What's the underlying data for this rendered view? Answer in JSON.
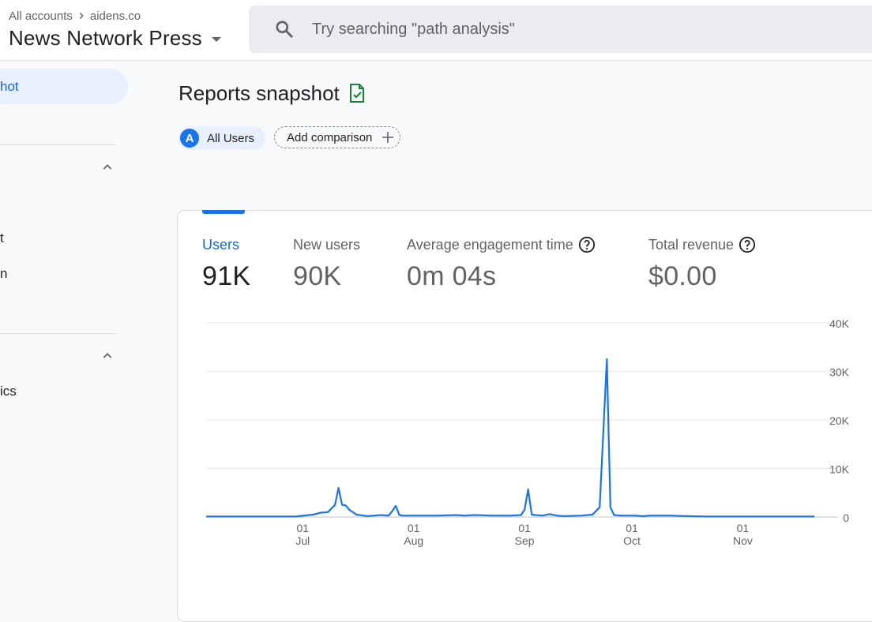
{
  "header": {
    "breadcrumb": [
      "All accounts",
      "aidens.co"
    ],
    "property_name": "News Network Press",
    "search_placeholder": "Try searching \"path analysis\""
  },
  "sidebar": {
    "active_item": "hot",
    "items": [
      "t",
      "n",
      "ics"
    ]
  },
  "main": {
    "title": "Reports snapshot",
    "comparison_chip": {
      "avatar": "A",
      "label": "All Users"
    },
    "add_comparison": "Add comparison"
  },
  "metrics": [
    {
      "label": "Users",
      "value": "91K",
      "active": true
    },
    {
      "label": "New users",
      "value": "90K",
      "active": false
    },
    {
      "label": "Average engagement time",
      "value": "0m 04s",
      "active": false
    },
    {
      "label": "Total revenue",
      "value": "$0.00",
      "active": false
    }
  ],
  "colors": {
    "accent": "#1a73e8",
    "line": "#1a73e8",
    "active_text": "#1967d2"
  },
  "chart_data": {
    "type": "line",
    "y_ticks": [
      "40K",
      "30K",
      "20K",
      "10K",
      "0"
    ],
    "ylim": [
      0,
      40000
    ],
    "x_ticks": [
      {
        "day": "01",
        "month": "Jul"
      },
      {
        "day": "01",
        "month": "Aug"
      },
      {
        "day": "01",
        "month": "Sep"
      },
      {
        "day": "01",
        "month": "Oct"
      },
      {
        "day": "01",
        "month": "Nov"
      }
    ],
    "x_range": [
      "2023-06-04",
      "2023-11-21"
    ],
    "grid": true,
    "series": [
      {
        "values": [
          [
            0,
            100
          ],
          [
            25,
            100
          ],
          [
            30,
            500
          ],
          [
            32,
            900
          ],
          [
            34,
            1000
          ],
          [
            36,
            2500
          ],
          [
            37,
            6000
          ],
          [
            38,
            2500
          ],
          [
            39,
            2400
          ],
          [
            40,
            1500
          ],
          [
            42,
            500
          ],
          [
            44,
            300
          ],
          [
            45,
            200
          ],
          [
            47,
            300
          ],
          [
            49,
            400
          ],
          [
            51,
            300
          ],
          [
            52,
            1200
          ],
          [
            53,
            2300
          ],
          [
            54,
            400
          ],
          [
            55,
            300
          ],
          [
            60,
            300
          ],
          [
            65,
            300
          ],
          [
            70,
            400
          ],
          [
            72,
            300
          ],
          [
            75,
            400
          ],
          [
            80,
            300
          ],
          [
            85,
            300
          ],
          [
            88,
            400
          ],
          [
            89,
            1500
          ],
          [
            90,
            5700
          ],
          [
            91,
            500
          ],
          [
            92,
            400
          ],
          [
            94,
            300
          ],
          [
            96,
            600
          ],
          [
            98,
            300
          ],
          [
            100,
            200
          ],
          [
            105,
            300
          ],
          [
            108,
            500
          ],
          [
            110,
            2000
          ],
          [
            112,
            32500
          ],
          [
            113,
            2000
          ],
          [
            114,
            400
          ],
          [
            116,
            300
          ],
          [
            120,
            300
          ],
          [
            122,
            200
          ],
          [
            124,
            300
          ],
          [
            130,
            300
          ],
          [
            134,
            200
          ],
          [
            140,
            100
          ],
          [
            170,
            100
          ]
        ]
      }
    ]
  }
}
